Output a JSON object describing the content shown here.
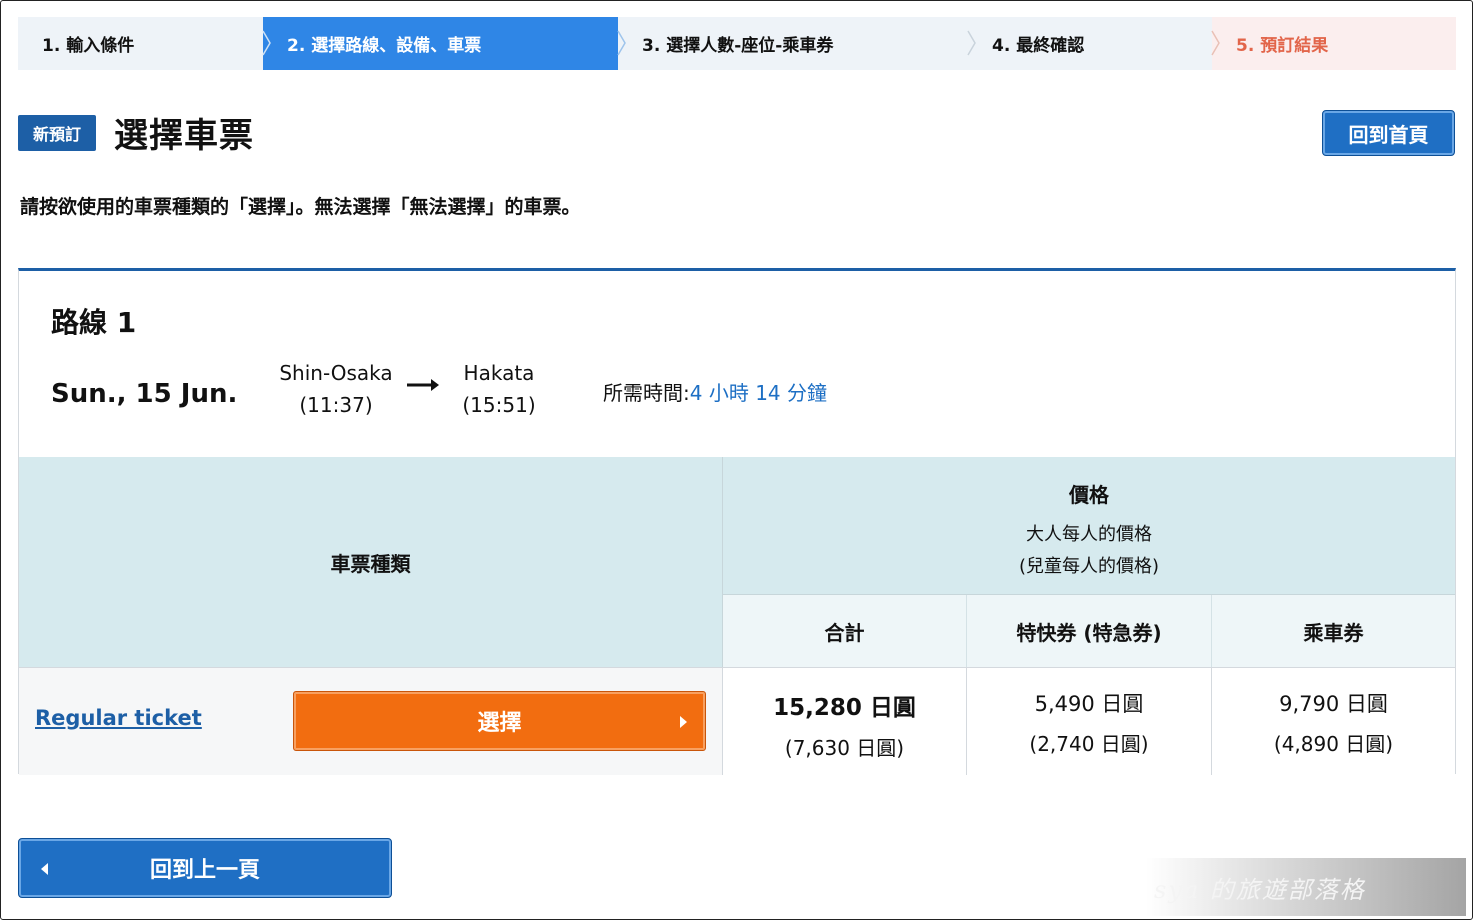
{
  "stepper": [
    {
      "label": "1.  輸入條件"
    },
    {
      "label": "2.  選擇路線、設備、車票"
    },
    {
      "label": "3.  選擇人數-座位-乘車券"
    },
    {
      "label": "4.  最終確認"
    },
    {
      "label": "5.  預訂結果"
    }
  ],
  "header": {
    "badge": "新預訂",
    "title": "選擇車票",
    "home_button": "回到首頁"
  },
  "instruction": "請按欲使用的車票種類的「選擇」。無法選擇「無法選擇」的車票。",
  "route": {
    "title": "路線 1",
    "date": "Sun., 15 Jun.",
    "from_station": "Shin-Osaka",
    "from_time": "(11:37)",
    "to_station": "Hakata",
    "to_time": "(15:51)",
    "duration_label": "所需時間:",
    "duration_value": "4 小時 14 分鐘"
  },
  "table": {
    "ticket_type_header": "車票種類",
    "price_header": "價格",
    "price_sub1": "大人每人的價格",
    "price_sub2": "(兒童每人的價格)",
    "col_total": "合計",
    "col_express": "特快券 (特急券)",
    "col_fare": "乘車券",
    "rows": [
      {
        "ticket_name": "Regular ticket",
        "select_label": "選擇",
        "total_adult": "15,280 日圓",
        "total_child": "(7,630 日圓)",
        "express_adult": "5,490 日圓",
        "express_child": "(2,740 日圓)",
        "fare_adult": "9,790 日圓",
        "fare_child": "(4,890 日圓)"
      }
    ]
  },
  "back_button": "回到上一頁",
  "watermark": "sya 的旅遊部落格",
  "colors": {
    "active_step": "#2f86e6",
    "result_step_text": "#e2654a",
    "primary_button": "#1f6fc4",
    "select_button": "#f26d10",
    "table_header": "#d6eaee"
  }
}
